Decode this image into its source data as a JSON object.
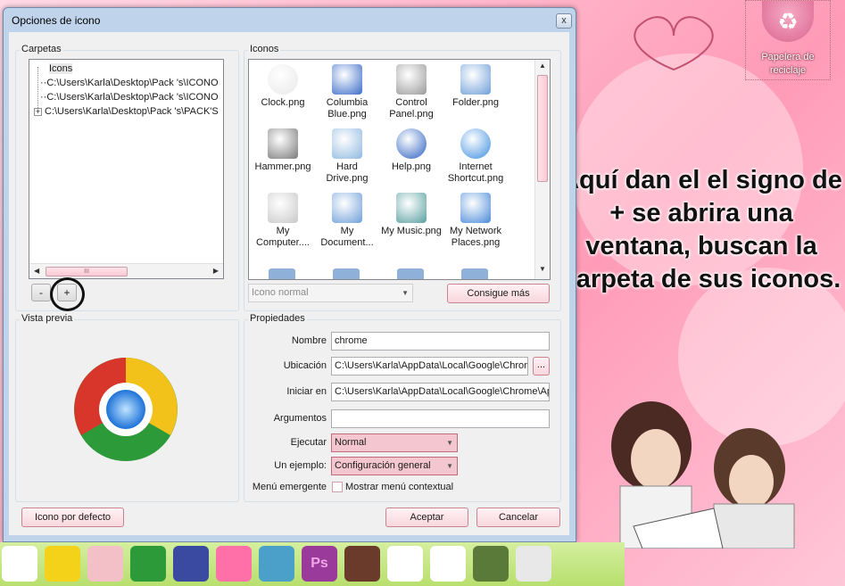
{
  "desktop": {
    "recycle_bin_label": "Papelera de reciclaje",
    "annotation": "Aquí dan el el signo de + se abrira una ventana, buscan la carpeta de sus iconos."
  },
  "dialog": {
    "title": "Opciones de icono",
    "close_label": "x",
    "folders": {
      "label": "Carpetas",
      "items": [
        "Icons",
        "C:\\Users\\Karla\\Desktop\\Pack 's\\ICONO",
        "C:\\Users\\Karla\\Desktop\\Pack 's\\ICONO",
        "C:\\Users\\Karla\\Desktop\\Pack 's\\PACK'S"
      ],
      "scroll_grip": "III",
      "remove_label": "-",
      "add_label": "+"
    },
    "icons": {
      "label": "Iconos",
      "items": [
        {
          "label": "Clock.png",
          "icon": "clock-icon"
        },
        {
          "label": "Columbia Blue.png",
          "icon": "rocket-icon"
        },
        {
          "label": "Control Panel.png",
          "icon": "tools-icon"
        },
        {
          "label": "Folder.png",
          "icon": "folder-icon"
        },
        {
          "label": "Hammer.png",
          "icon": "hammer-icon"
        },
        {
          "label": "Hard Drive.png",
          "icon": "hard-drive-icon"
        },
        {
          "label": "Help.png",
          "icon": "help-icon"
        },
        {
          "label": "Internet Shortcut.png",
          "icon": "globe-icon"
        },
        {
          "label": "My Computer....",
          "icon": "computer-icon"
        },
        {
          "label": "My Document...",
          "icon": "documents-icon"
        },
        {
          "label": "My Music.png",
          "icon": "music-folder-icon"
        },
        {
          "label": "My Network Places.png",
          "icon": "network-icon"
        }
      ],
      "state_combo": "Icono normal",
      "get_more_label": "Consigue más"
    },
    "preview": {
      "label": "Vista previa",
      "icon": "chrome-icon"
    },
    "properties": {
      "label": "Propiedades",
      "name_label": "Nombre",
      "name_value": "chrome",
      "location_label": "Ubicación",
      "location_value": "C:\\Users\\Karla\\AppData\\Local\\Google\\Chrom",
      "browse_label": "...",
      "start_in_label": "Iniciar en",
      "start_in_value": "C:\\Users\\Karla\\AppData\\Local\\Google\\Chrome\\Ap",
      "args_label": "Argumentos",
      "args_value": "",
      "run_label": "Ejecutar",
      "run_value": "Normal",
      "example_label": "Un ejemplo:",
      "example_value": "Configuración general",
      "menu_label": "Menú emergente",
      "menu_checkbox_label": "Mostrar menú contextual"
    },
    "buttons": {
      "default_icon": "Icono por defecto",
      "accept": "Aceptar",
      "cancel": "Cancelar"
    }
  },
  "taskbar": {
    "items": [
      "heart-outline-icon",
      "chick-icon",
      "cupcake-icon",
      "chrome-icon",
      "galaxy-icon",
      "heart-icon",
      "pixel-character-icon",
      "photoshop-icon",
      "anime-avatar-icon",
      "panda-icon",
      "bunny-icon",
      "character-icon",
      "thermometer-icon"
    ],
    "photoshop_text": "Ps"
  }
}
